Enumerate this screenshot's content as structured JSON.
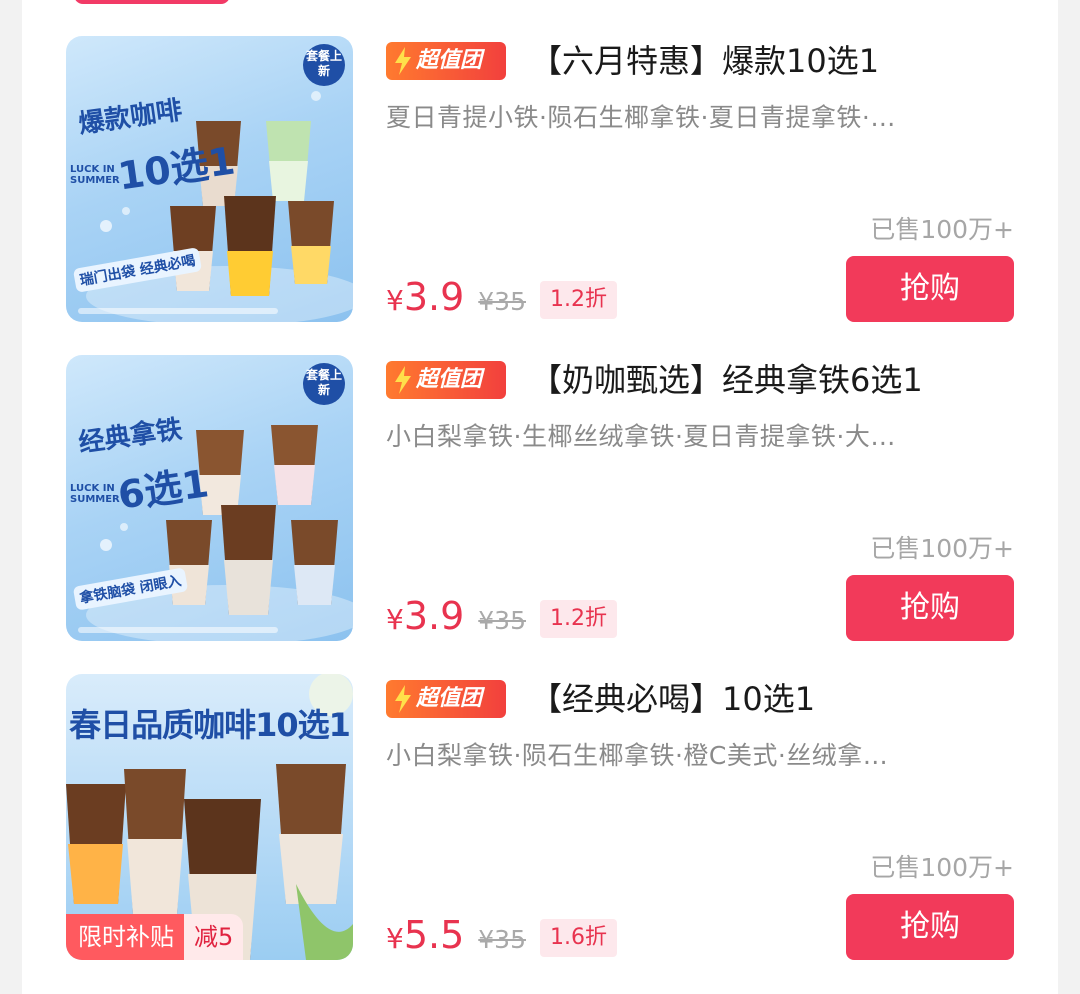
{
  "colors": {
    "accent": "#f23a5a",
    "price": "#e8334f",
    "tag_start": "#ff7a2f",
    "tag_end": "#f2403d"
  },
  "products": [
    {
      "tag": "超值团",
      "title": "【六月特惠】爆款10选1",
      "description": "夏日青提小铁·陨石生椰拿铁·夏日青提拿铁·…",
      "sold": "已售100万+",
      "price": "3.9",
      "currency": "¥",
      "original_price": "¥35",
      "discount": "1.2折",
      "buy_label": "抢购",
      "image": {
        "line1": "爆款咖啡",
        "line2": "10选1",
        "luck": "LUCK IN SUMMER",
        "badge": "套餐上新",
        "slogan": "瑞门出袋 经典必喝"
      }
    },
    {
      "tag": "超值团",
      "title": "【奶咖甄选】经典拿铁6选1",
      "description": "小白梨拿铁·生椰丝绒拿铁·夏日青提拿铁·大…",
      "sold": "已售100万+",
      "price": "3.9",
      "currency": "¥",
      "original_price": "¥35",
      "discount": "1.2折",
      "buy_label": "抢购",
      "image": {
        "line1": "经典拿铁",
        "line2": "6选1",
        "luck": "LUCK IN SUMMER",
        "badge": "套餐上新",
        "slogan": "拿铁脑袋 闭眼入"
      }
    },
    {
      "tag": "超值团",
      "title": "【经典必喝】10选1",
      "description": "小白梨拿铁·陨石生椰拿铁·橙C美式·丝绒拿…",
      "sold": "已售100万+",
      "price": "5.5",
      "currency": "¥",
      "original_price": "¥35",
      "discount": "1.6折",
      "buy_label": "抢购",
      "image": {
        "headline": "春日品质咖啡10选1",
        "subsidy_label": "限时补贴",
        "subsidy_value": "减5"
      }
    }
  ]
}
